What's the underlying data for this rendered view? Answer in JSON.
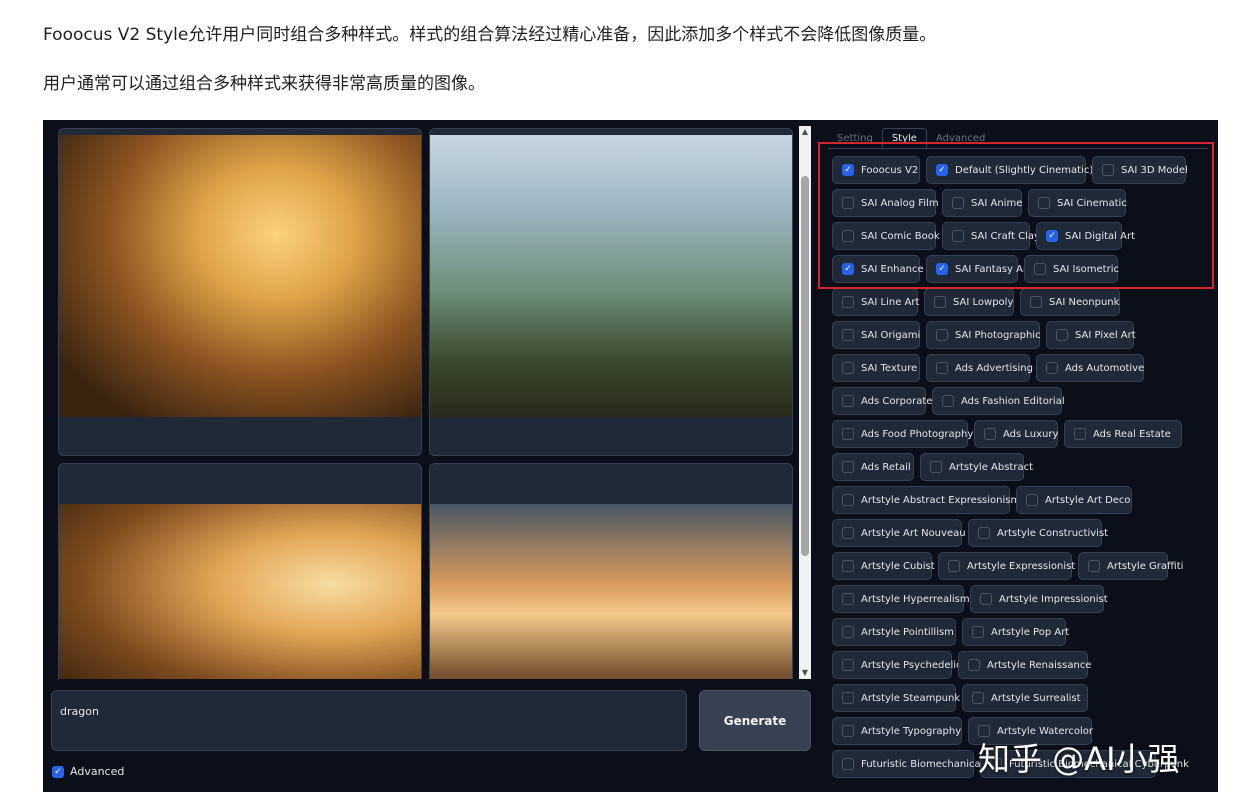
{
  "article": {
    "line1": "Fooocus V2 Style允许用户同时组合多种样式。样式的组合算法经过精心准备，因此添加多个样式不会降低图像质量。",
    "line2": "用户通常可以通过组合多种样式来获得非常高质量的图像。"
  },
  "app": {
    "prompt_value": "dragon",
    "generate_label": "Generate",
    "advanced_label": "Advanced",
    "advanced_checked": true,
    "tabs": [
      {
        "label": "Setting",
        "active": false
      },
      {
        "label": "Style",
        "active": true
      },
      {
        "label": "Advanced",
        "active": false
      }
    ],
    "styles": [
      {
        "label": "Fooocus V2",
        "checked": true
      },
      {
        "label": "Default (Slightly Cinematic)",
        "checked": true
      },
      {
        "label": "SAI 3D Model",
        "checked": false
      },
      {
        "label": "SAI Analog Film",
        "checked": false
      },
      {
        "label": "SAI Anime",
        "checked": false
      },
      {
        "label": "SAI Cinematic",
        "checked": false
      },
      {
        "label": "SAI Comic Book",
        "checked": false
      },
      {
        "label": "SAI Craft Clay",
        "checked": false
      },
      {
        "label": "SAI Digital Art",
        "checked": true
      },
      {
        "label": "SAI Enhance",
        "checked": true
      },
      {
        "label": "SAI Fantasy Art",
        "checked": true
      },
      {
        "label": "SAI Isometric",
        "checked": false
      },
      {
        "label": "SAI Line Art",
        "checked": false
      },
      {
        "label": "SAI Lowpoly",
        "checked": false
      },
      {
        "label": "SAI Neonpunk",
        "checked": false
      },
      {
        "label": "SAI Origami",
        "checked": false
      },
      {
        "label": "SAI Photographic",
        "checked": false
      },
      {
        "label": "SAI Pixel Art",
        "checked": false
      },
      {
        "label": "SAI Texture",
        "checked": false
      },
      {
        "label": "Ads Advertising",
        "checked": false
      },
      {
        "label": "Ads Automotive",
        "checked": false
      },
      {
        "label": "Ads Corporate",
        "checked": false
      },
      {
        "label": "Ads Fashion Editorial",
        "checked": false
      },
      {
        "label": "Ads Food Photography",
        "checked": false
      },
      {
        "label": "Ads Luxury",
        "checked": false
      },
      {
        "label": "Ads Real Estate",
        "checked": false
      },
      {
        "label": "Ads Retail",
        "checked": false
      },
      {
        "label": "Artstyle Abstract",
        "checked": false
      },
      {
        "label": "Artstyle Abstract Expressionism",
        "checked": false
      },
      {
        "label": "Artstyle Art Deco",
        "checked": false
      },
      {
        "label": "Artstyle Art Nouveau",
        "checked": false
      },
      {
        "label": "Artstyle Constructivist",
        "checked": false
      },
      {
        "label": "Artstyle Cubist",
        "checked": false
      },
      {
        "label": "Artstyle Expressionist",
        "checked": false
      },
      {
        "label": "Artstyle Graffiti",
        "checked": false
      },
      {
        "label": "Artstyle Hyperrealism",
        "checked": false
      },
      {
        "label": "Artstyle Impressionist",
        "checked": false
      },
      {
        "label": "Artstyle Pointillism",
        "checked": false
      },
      {
        "label": "Artstyle Pop Art",
        "checked": false
      },
      {
        "label": "Artstyle Psychedelic",
        "checked": false
      },
      {
        "label": "Artstyle Renaissance",
        "checked": false
      },
      {
        "label": "Artstyle Steampunk",
        "checked": false
      },
      {
        "label": "Artstyle Surrealist",
        "checked": false
      },
      {
        "label": "Artstyle Typography",
        "checked": false
      },
      {
        "label": "Artstyle Watercolor",
        "checked": false
      },
      {
        "label": "Futuristic Biomechanical",
        "checked": false
      },
      {
        "label": "Futuristic Biomechanical Cyberpunk",
        "checked": false
      }
    ]
  },
  "watermark": "知乎 @AI小强",
  "colors": {
    "app_bg": "#0b0f19",
    "chip_bg": "#1f2937",
    "checkbox_checked": "#2563eb",
    "highlight_box": "#d7262b"
  }
}
